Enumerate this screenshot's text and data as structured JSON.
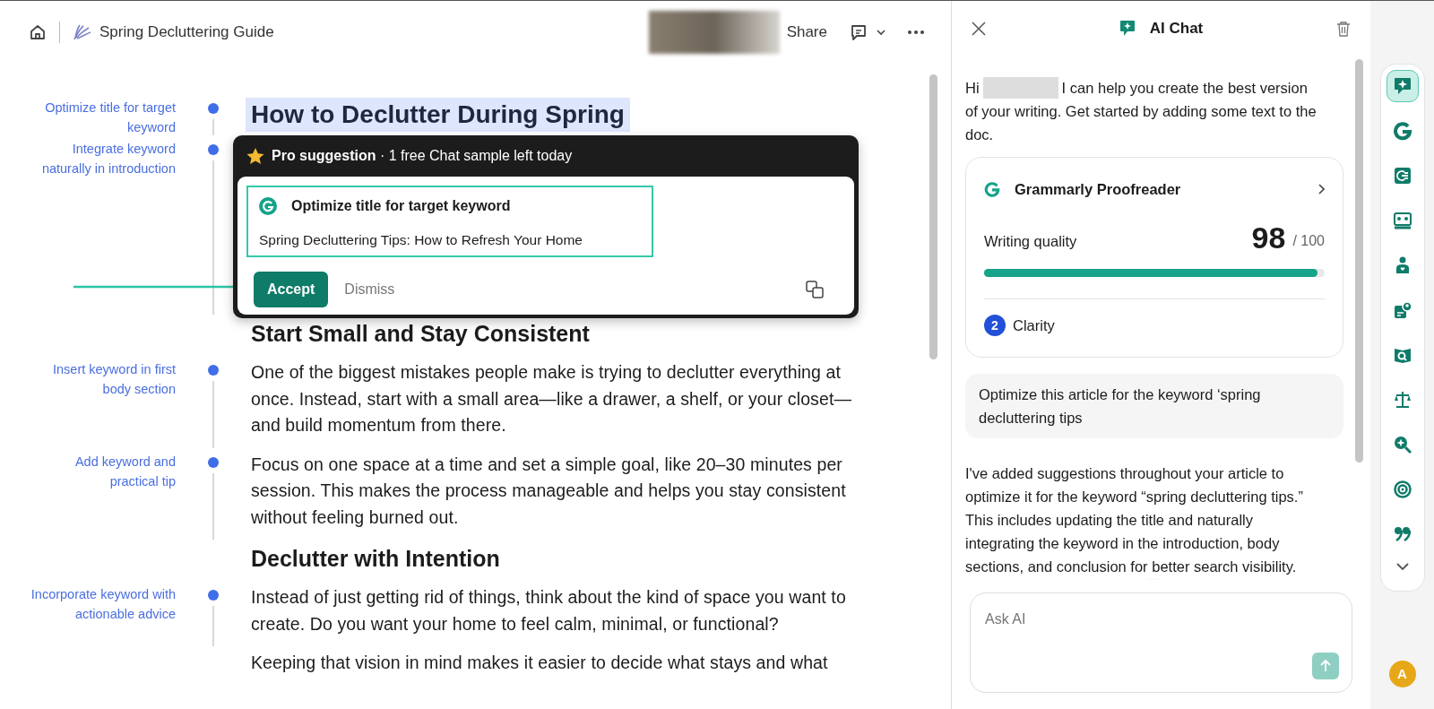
{
  "header": {
    "doc_title": "Spring Decluttering Guide",
    "share": "Share"
  },
  "document": [
    {
      "kind": "title",
      "text": "How to Declutter During Spring",
      "highlighted": true,
      "note": "Optimize title for target keyword"
    },
    {
      "kind": "covered",
      "note": "Integrate keyword naturally in introduction"
    },
    {
      "kind": "heading",
      "text": "Start Small and Stay Consistent"
    },
    {
      "kind": "paragraph",
      "text": "One of the biggest mistakes people make is trying to declutter everything at once. Instead, start with a small area—like a drawer, a shelf, or your closet—and build momentum from there.",
      "note": "Insert keyword in first body section"
    },
    {
      "kind": "paragraph",
      "text": "Focus on one space at a time and set a simple goal, like 20–30 minutes per session. This makes the process manageable and helps you stay consistent without feeling burned out.",
      "note": "Add keyword and practical tip"
    },
    {
      "kind": "heading",
      "text": "Declutter with Intention"
    },
    {
      "kind": "paragraph",
      "text": "Instead of just getting rid of things, think about the kind of space you want to create. Do you want your home to feel calm, minimal, or functional?",
      "note": "Incorporate keyword with actionable advice"
    },
    {
      "kind": "paragraph",
      "text": "Keeping that vision in mind makes it easier to decide what stays and what"
    }
  ],
  "suggestion": {
    "banner": "**Pro suggestion** · 1 free Chat sample left today",
    "title": "Optimize title for target keyword",
    "replacement": "Spring Decluttering Tips: How to Refresh Your Home",
    "accept": "Accept",
    "dismiss": "Dismiss"
  },
  "chat": {
    "title": "AI Chat",
    "greeting_start": "Hi",
    "greeting_first": "I can help you create the best version",
    "greeting_rest": "of your writing. Get started by adding some text to the doc.",
    "proofreader": {
      "title": "Grammarly Proofreader",
      "metric": "Writing quality",
      "score": "98",
      "max": "/ 100",
      "level": 0.98,
      "issue_count": "2",
      "issue_label": "Clarity"
    },
    "prompt": "Optimize this article for the keyword ‘spring decluttering tips",
    "reply": "I've added suggestions throughout your article to optimize it for the keyword “spring decluttering tips.” This includes updating the title and naturally integrating the keyword in the introduction, body sections, and conclusion for better search visibility.",
    "input": {
      "placeholder": "Ask AI"
    }
  },
  "rail": {
    "items": [
      {
        "kind": "chat",
        "selected": true
      },
      {
        "kind": "g",
        "selected": false
      },
      {
        "kind": "list",
        "selected": false
      },
      {
        "kind": "group",
        "selected": false
      },
      {
        "kind": "person",
        "selected": false
      },
      {
        "kind": "card",
        "selected": false
      },
      {
        "kind": "book",
        "selected": false
      },
      {
        "kind": "scales",
        "selected": false
      },
      {
        "kind": "search",
        "selected": false
      },
      {
        "kind": "target",
        "selected": false
      },
      {
        "kind": "quote",
        "selected": false
      }
    ],
    "avatar": "A"
  }
}
